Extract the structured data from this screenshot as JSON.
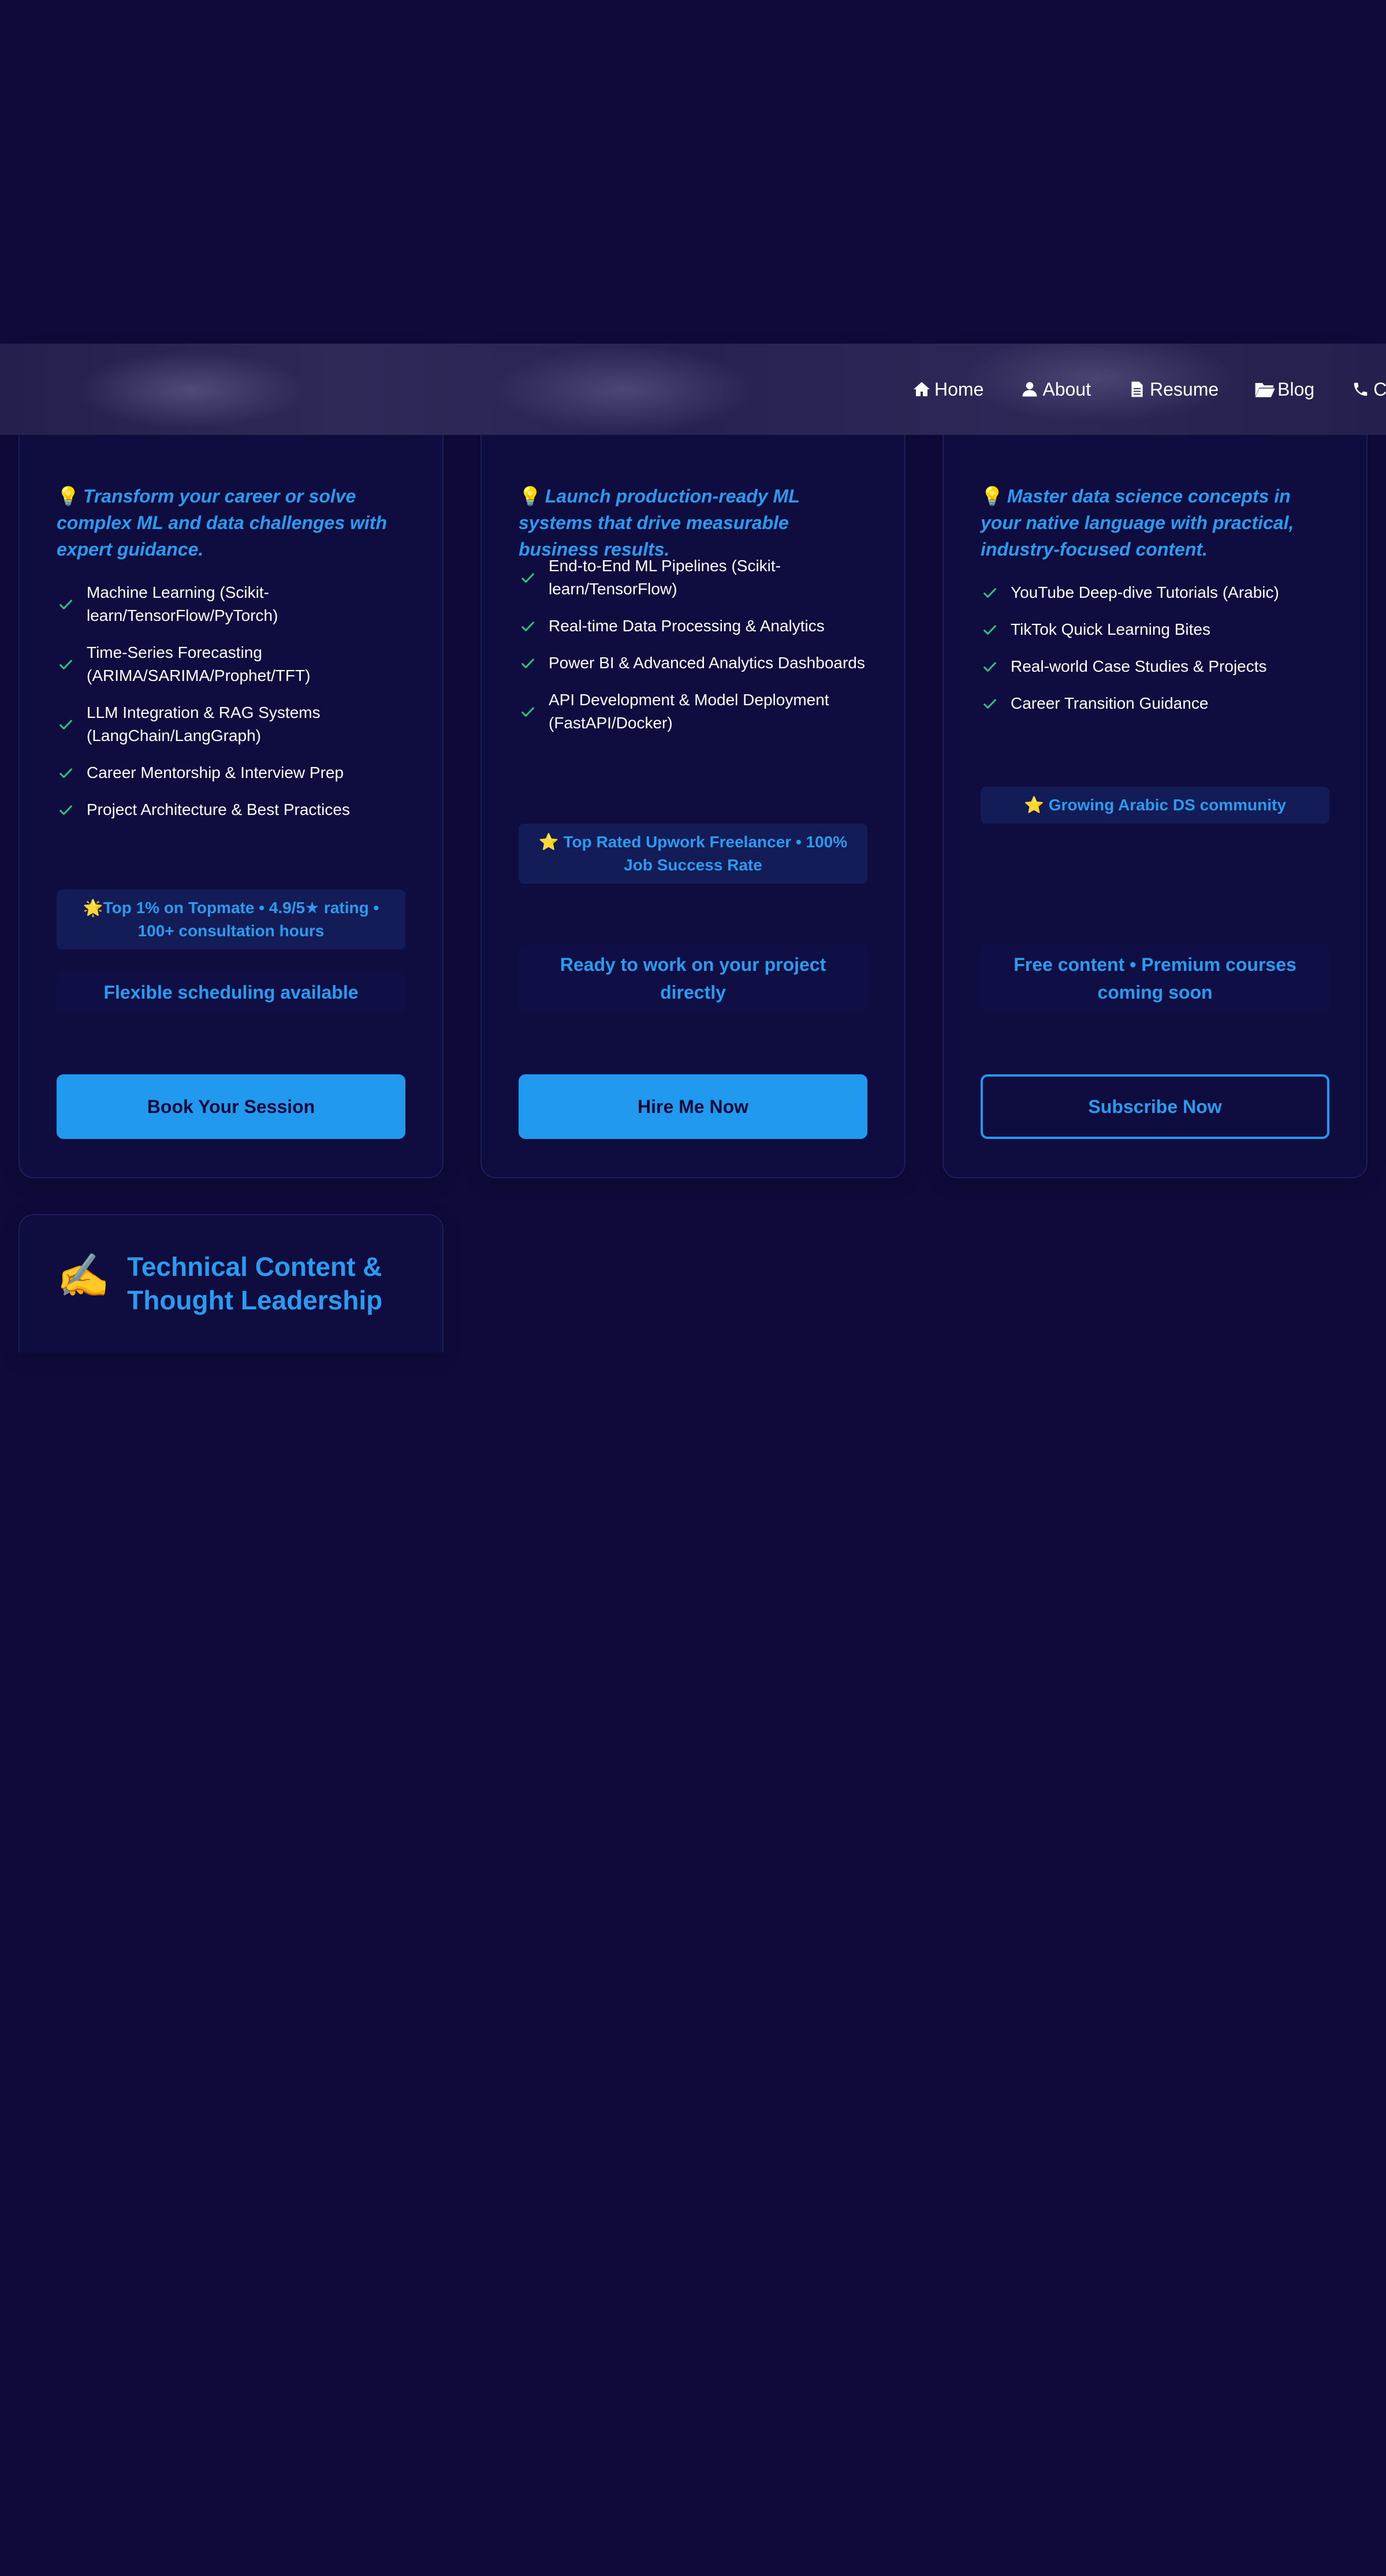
{
  "nav": {
    "links": [
      {
        "label": "Home",
        "icon": "home-icon"
      },
      {
        "label": "About",
        "icon": "user-icon"
      },
      {
        "label": "Resume",
        "icon": "document-icon"
      },
      {
        "label": "Blog",
        "icon": "folder-icon"
      },
      {
        "label": "Co",
        "icon": "phone-icon"
      }
    ]
  },
  "cards": [
    {
      "tagline": "Transform your career or solve complex ML and data challenges with expert guidance.",
      "features": [
        "Machine Learning (Scikit-learn/TensorFlow/PyTorch)",
        "Time-Series Forecasting (ARIMA/SARIMA/Prophet/TFT)",
        "LLM Integration & RAG Systems (LangChain/LangGraph)",
        "Career Mentorship & Interview Prep",
        "Project Architecture & Best Practices"
      ],
      "badge": "🌟Top 1% on Topmate • 4.9/5★ rating • 100+ consultation hours",
      "note": "Flexible scheduling available",
      "button": "Book Your Session"
    },
    {
      "tagline": "Launch production-ready ML systems that drive measurable business results.",
      "features": [
        "End-to-End ML Pipelines (Scikit-learn/TensorFlow)",
        "Real-time Data Processing & Analytics",
        "Power BI & Advanced Analytics Dashboards",
        "API Development & Model Deployment (FastAPI/Docker)"
      ],
      "badge": "⭐ Top Rated Upwork Freelancer • 100% Job Success Rate",
      "note": "Ready to work on your project directly",
      "button": "Hire Me Now"
    },
    {
      "tagline": "Master data science concepts in your native language with practical, industry-focused content.",
      "features": [
        "YouTube Deep-dive Tutorials (Arabic)",
        "TikTok Quick Learning Bites",
        "Real-world Case Studies & Projects",
        "Career Transition Guidance"
      ],
      "badge": "⭐ Growing Arabic DS community",
      "note": "Free content • Premium courses coming soon",
      "button": "Subscribe Now"
    },
    {
      "emoji": "✍️",
      "title": "Technical Content & Thought Leadership"
    }
  ],
  "colors": {
    "background": "#0e0b3b",
    "card": "#0f0d40",
    "accent": "#2199ee",
    "check": "#2ec27e"
  }
}
